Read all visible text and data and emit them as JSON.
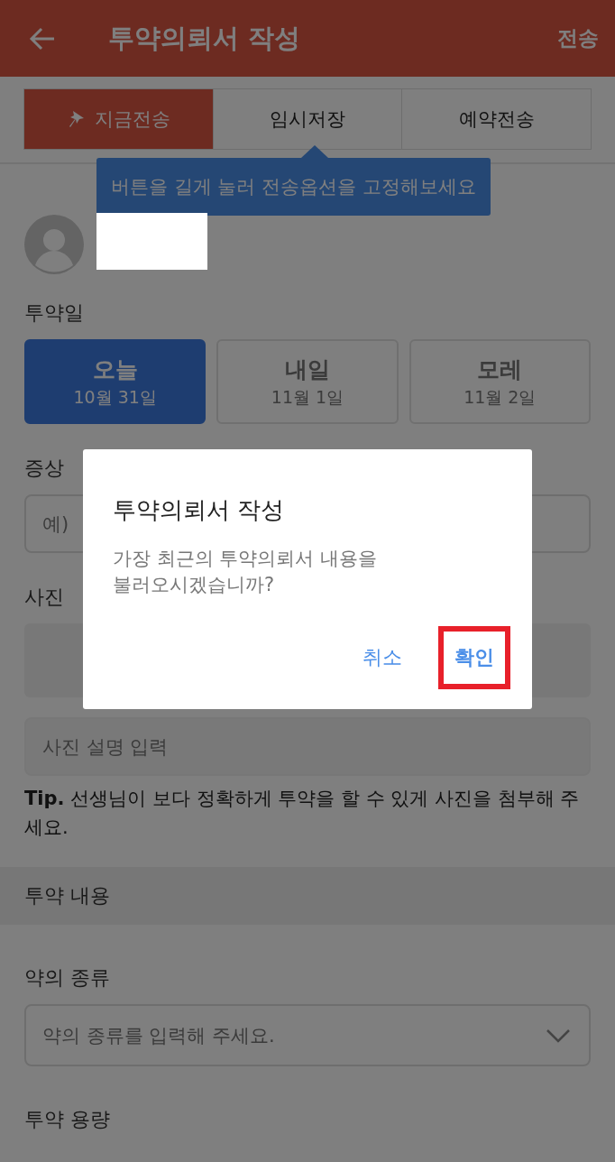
{
  "app_bar": {
    "title": "투약의뢰서 작성",
    "action": "전송"
  },
  "send_options": [
    {
      "label": "지금전송",
      "selected": true
    },
    {
      "label": "임시저장",
      "selected": false
    },
    {
      "label": "예약전송",
      "selected": false
    }
  ],
  "tooltip": "버튼을 길게 눌러 전송옵션을 고정해보세요",
  "dosing_date": {
    "label": "투약일",
    "options": [
      {
        "day": "오늘",
        "date": "10월 31일",
        "selected": true
      },
      {
        "day": "내일",
        "date": "11월 1일",
        "selected": false
      },
      {
        "day": "모레",
        "date": "11월 2일",
        "selected": false
      }
    ]
  },
  "symptom": {
    "label": "증상",
    "placeholder": "예)"
  },
  "photo": {
    "label": "사진"
  },
  "photo_caption": {
    "placeholder": "사진 설명 입력"
  },
  "tip": "**Tip.** 선생님이 보다 정확하게 투약을 할 수 있게 사진을 첨부해 주세요.",
  "section": "투약 내용",
  "medicine_type": {
    "label": "약의 종류",
    "placeholder": "약의 종류를 입력해 주세요."
  },
  "dose": {
    "label": "투약 용량"
  },
  "dialog": {
    "title": "투약의뢰서 작성",
    "message": "가장 최근의 투약의뢰서 내용을 불러오시겠습니까?",
    "buttons": [
      {
        "label": "취소",
        "highlighted": false
      },
      {
        "label": "확인",
        "highlighted": true
      }
    ]
  }
}
